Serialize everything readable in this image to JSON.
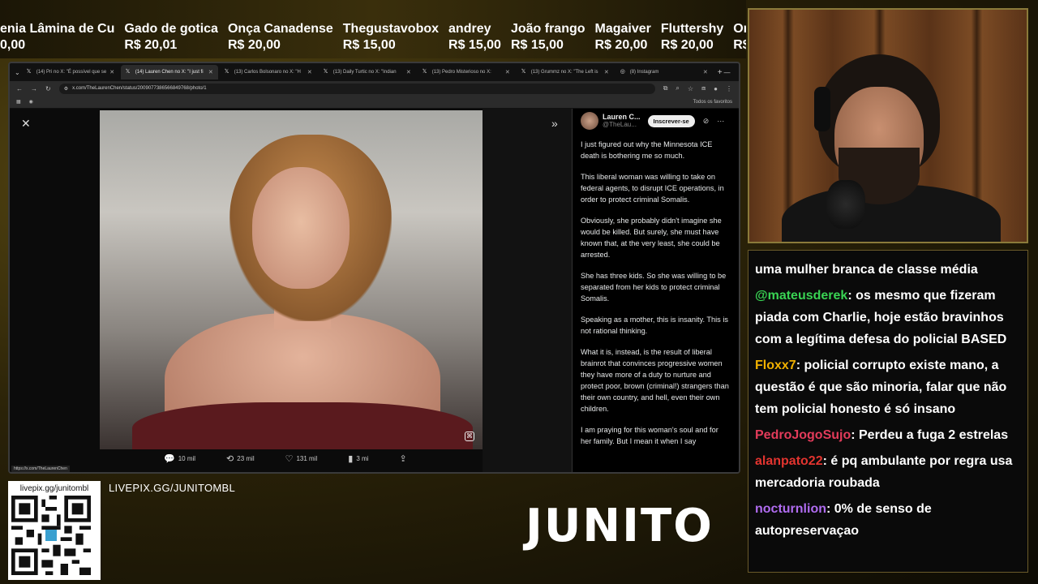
{
  "ticker": [
    {
      "name": "enia Lâmina de Cu",
      "amount": "0,00"
    },
    {
      "name": "Gado de gotica",
      "amount": "R$ 20,01"
    },
    {
      "name": "Onça Canadense",
      "amount": "R$ 20,00"
    },
    {
      "name": "Thegustavobox",
      "amount": "R$ 15,00"
    },
    {
      "name": "andrey",
      "amount": "R$ 15,00"
    },
    {
      "name": "João frango",
      "amount": "R$ 15,00"
    },
    {
      "name": "Magaiver",
      "amount": "R$ 20,00"
    },
    {
      "name": "Fluttershy",
      "amount": "R$ 20,00"
    },
    {
      "name": "Onça Ca",
      "amount": "R$ 20,0"
    }
  ],
  "browser": {
    "tabs": [
      {
        "label": "(14) Pri no X: \"É possível que se",
        "icon": "x-logo-icon"
      },
      {
        "label": "(14) Lauren Chen no X: \"I just fi",
        "icon": "x-logo-icon"
      },
      {
        "label": "(13) Carlos Bolsonaro no X: \"H",
        "icon": "x-logo-icon"
      },
      {
        "label": "(13) Daily Turtic no X: \"Indian",
        "icon": "x-logo-icon"
      },
      {
        "label": "(13) Pedro Misterioso no X:",
        "icon": "x-logo-icon"
      },
      {
        "label": "(13) Grummz no X: \"The Left is",
        "icon": "x-logo-icon"
      },
      {
        "label": "(8) Instagram",
        "icon": "instagram-icon"
      }
    ],
    "url": "x.com/TheLaurenChen/status/2009077386566849768/photo/1",
    "bookmarks_right": "Todos os favoritos",
    "status_url": "https://x.com/TheLaurenChen"
  },
  "post": {
    "name": "Lauren C...",
    "handle": "@TheLau...",
    "subscribe_label": "Inscrever-se",
    "paragraphs": [
      "I just figured out why the Minnesota ICE death is bothering me so much.",
      "This liberal woman was willing to take on federal agents, to disrupt ICE operations, in order to protect criminal Somalis.",
      "Obviously, she probably didn't imagine she would be killed. But surely, she must have known that, at the very least, she could be arrested.",
      "She has three kids. So she was willing to be separated from her kids to protect criminal Somalis.",
      "Speaking as a mother, this is insanity. This is not rational thinking.",
      "What it is, instead, is the result of liberal brainrot that convinces progressive women they have more of a duty to nurture and protect poor, brown (criminal!) strangers than their own country, and hell, even their own children.",
      "I am praying for this woman's soul and for her family. But I mean it when I say"
    ],
    "stats": {
      "replies": "10 mil",
      "reposts": "23 mil",
      "likes": "131 mil",
      "views": "3 mi"
    }
  },
  "chat": [
    {
      "user": "",
      "color": "#ffffff",
      "text": "uma mulher branca de classe média"
    },
    {
      "user": "@mateusderek",
      "color": "#39d353",
      "text": ": os mesmo que fizeram piada com Charlie, hoje estão bravinhos com a legítima defesa do policial BASED"
    },
    {
      "user": "Floxx7",
      "color": "#f0b000",
      "text": ": policial corrupto existe mano, a questão é que são minoria, falar que não tem policial honesto é só insano"
    },
    {
      "user": "PedroJogoSujo",
      "color": "#e23b5a",
      "text": ": Perdeu a fuga 2 estrelas"
    },
    {
      "user": "alanpato22",
      "color": "#e3342f",
      "text": ": é pq ambulante por regra usa mercadoria roubada"
    },
    {
      "user": "nocturnlion",
      "color": "#b06cf0",
      "text": ": 0% de senso de autopreservaçao"
    }
  ],
  "bottom": {
    "qr_label": "livepix.gg/junitombl",
    "livepix": "LIVEPIX.GG/JUNITOMBL",
    "brand": "JUNITO"
  }
}
